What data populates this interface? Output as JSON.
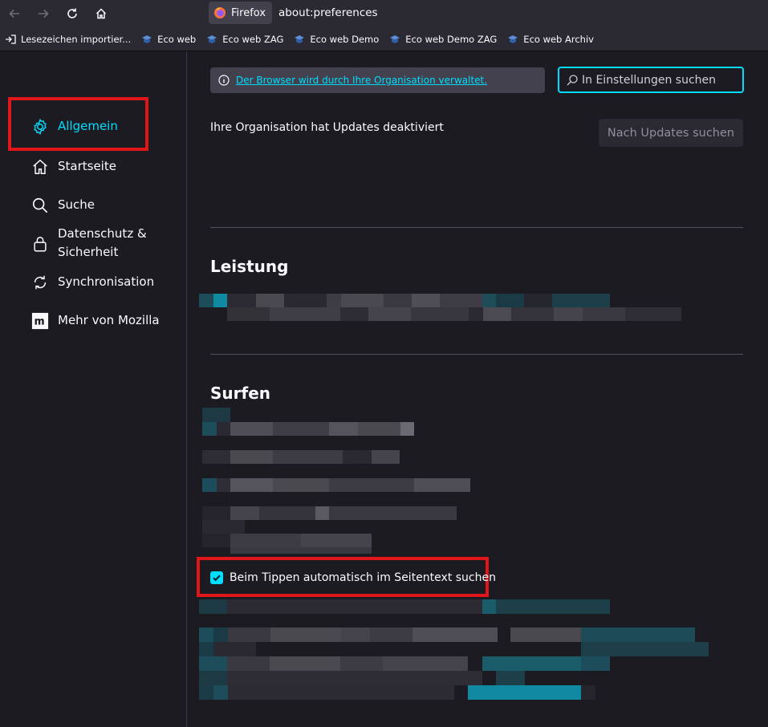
{
  "toolbar": {
    "identity_label": "Firefox",
    "url": "about:preferences"
  },
  "bookmarks": [
    {
      "label": "Lesezeichen importier...",
      "icon": "import-icon"
    },
    {
      "label": "Eco web",
      "icon": "bookmark-favicon"
    },
    {
      "label": "Eco web ZAG",
      "icon": "bookmark-favicon"
    },
    {
      "label": "Eco web Demo",
      "icon": "bookmark-favicon"
    },
    {
      "label": "Eco web Demo ZAG",
      "icon": "bookmark-favicon"
    },
    {
      "label": "Eco web Archiv",
      "icon": "bookmark-favicon"
    }
  ],
  "sidebar": {
    "items": [
      {
        "label": "Allgemein",
        "icon": "gear-icon",
        "selected": true
      },
      {
        "label": "Startseite",
        "icon": "home-icon"
      },
      {
        "label": "Suche",
        "icon": "search-icon"
      },
      {
        "label": "Datenschutz &\nSicherheit",
        "icon": "lock-icon"
      },
      {
        "label": "Synchronisation",
        "icon": "sync-icon"
      },
      {
        "label": "Mehr von Mozilla",
        "icon": "mozilla-icon"
      }
    ]
  },
  "main": {
    "policy_notice": "Der Browser wird durch Ihre Organisation verwaltet.",
    "search_placeholder": "In Einstellungen suchen",
    "updates_disabled_text": "Ihre Organisation hat Updates deaktiviert",
    "check_updates_button": "Nach Updates suchen",
    "section_performance": "Leistung",
    "section_browsing": "Surfen",
    "find_as_you_type_label": "Beim Tippen automatisch im Seitentext suchen",
    "find_as_you_type_checked": true
  },
  "colors": {
    "accent": "#00ddff",
    "highlight": "#e0161a",
    "background": "#1c1b22",
    "toolbar": "#2b2a33"
  }
}
